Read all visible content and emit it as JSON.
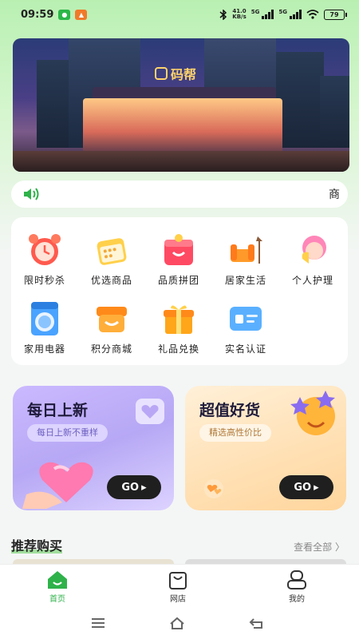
{
  "status_bar": {
    "time": "09:59",
    "net_speed": "41.0",
    "net_unit": "KB/s",
    "sig1": "5G",
    "sig2": "5G",
    "battery": "79"
  },
  "banner": {
    "brand": "码帮"
  },
  "notice": {
    "text": "商"
  },
  "categories": [
    {
      "label": "限时秒杀",
      "icon": "alarm-clock-icon"
    },
    {
      "label": "优选商品",
      "icon": "calendar-icon"
    },
    {
      "label": "品质拼团",
      "icon": "shopping-bag-icon"
    },
    {
      "label": "居家生活",
      "icon": "sofa-lamp-icon"
    },
    {
      "label": "个人护理",
      "icon": "person-care-icon"
    },
    {
      "label": "家用电器",
      "icon": "washing-machine-icon"
    },
    {
      "label": "积分商城",
      "icon": "basket-icon"
    },
    {
      "label": "礼品兑换",
      "icon": "gift-icon"
    },
    {
      "label": "实名认证",
      "icon": "id-card-icon"
    }
  ],
  "promos": [
    {
      "title": "每日上新",
      "subtitle": "每日上新不重样",
      "go": "GO"
    },
    {
      "title": "超值好货",
      "subtitle": "精选高性价比",
      "go": "GO"
    }
  ],
  "recommend": {
    "title": "推荐购买",
    "view_all": "查看全部 〉"
  },
  "tabs": [
    {
      "label": "首页",
      "active": true
    },
    {
      "label": "网店",
      "active": false
    },
    {
      "label": "我的",
      "active": false
    }
  ],
  "colors": {
    "accent": "#2fb24a",
    "bg_top": "#b9f0b2"
  }
}
